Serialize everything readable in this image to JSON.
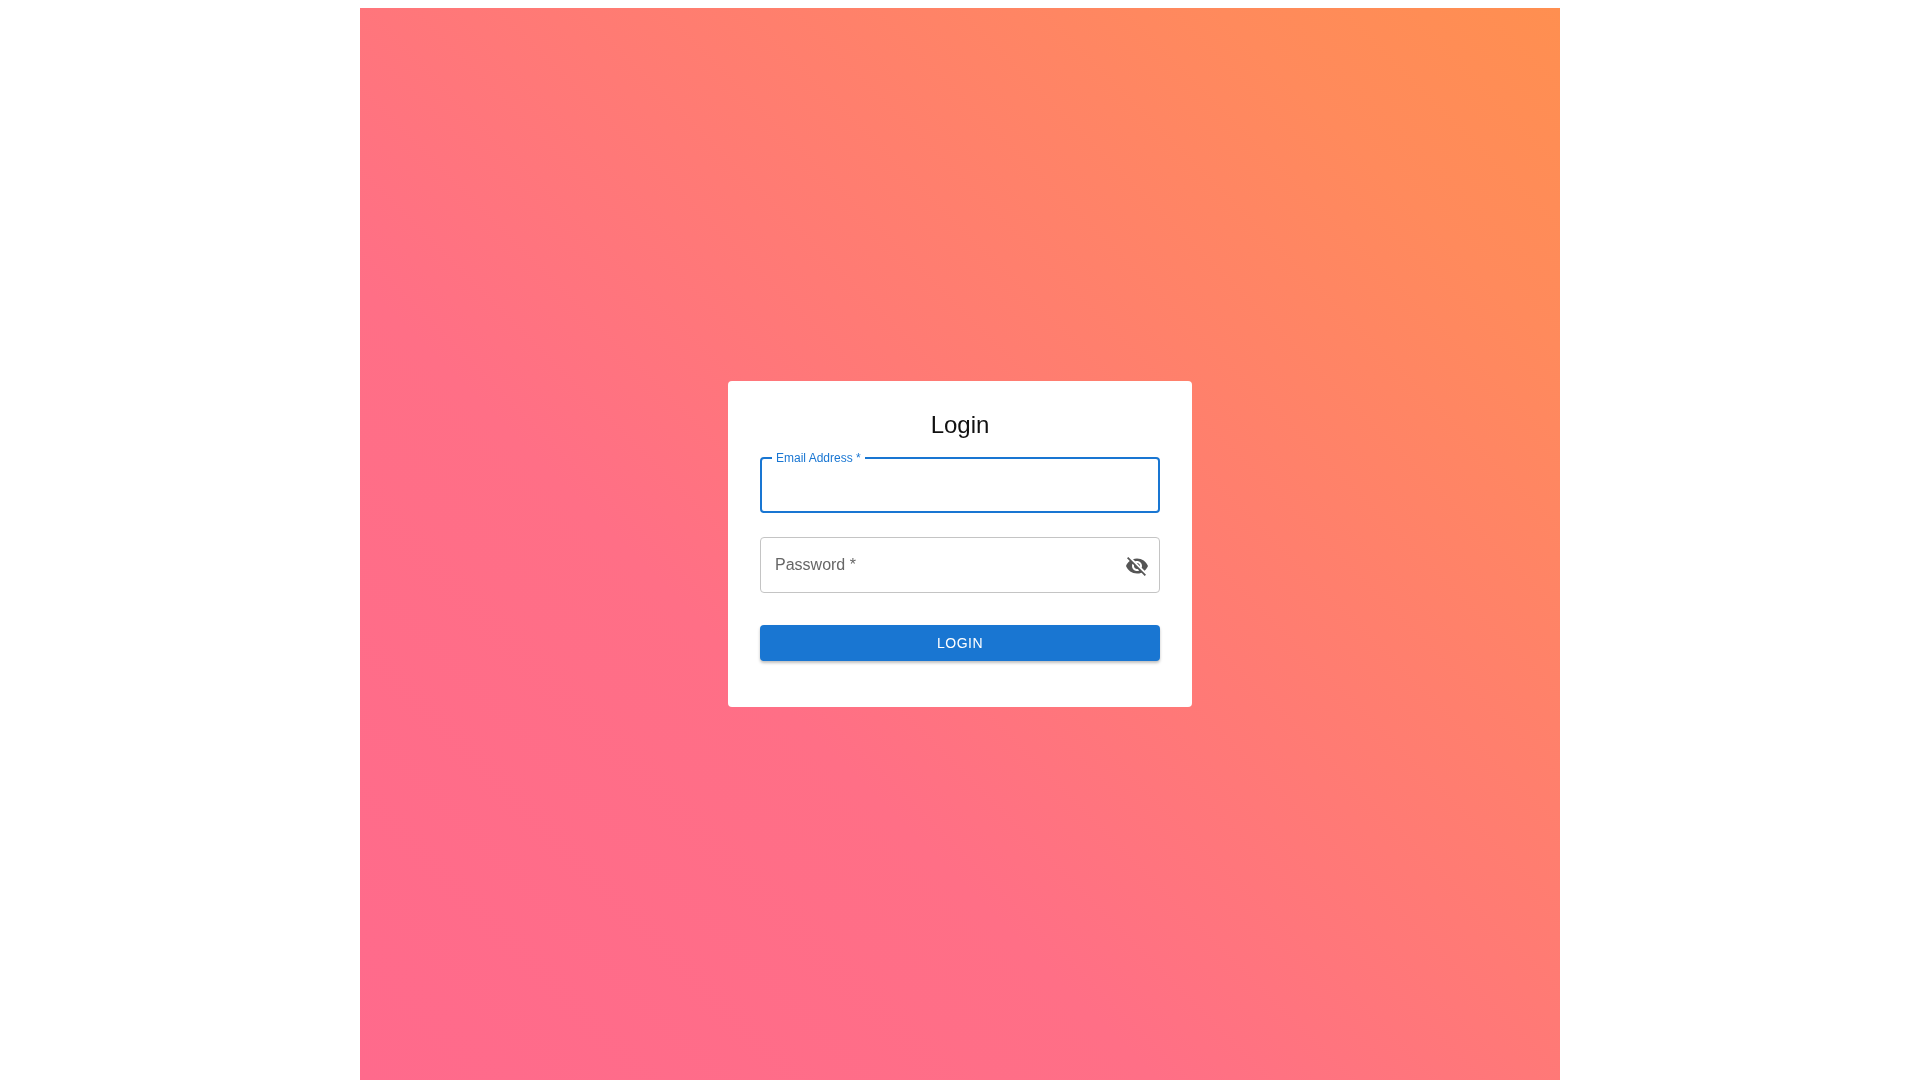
{
  "title": "Login",
  "fields": [
    {
      "kind": "text",
      "label": "Email Address *",
      "focused": true
    },
    {
      "kind": "password",
      "label": "Password *",
      "focused": false,
      "password_visible": false
    }
  ],
  "button": "LOGIN"
}
